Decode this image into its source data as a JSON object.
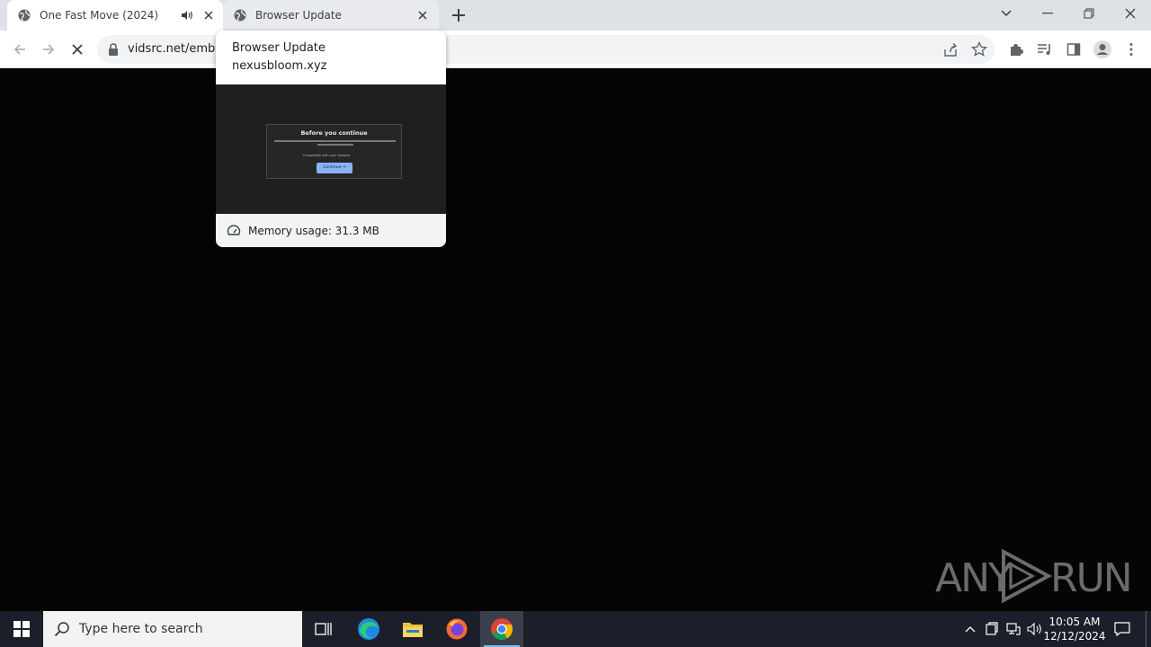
{
  "browser": {
    "tabs": [
      {
        "title": "One Fast Move (2024)",
        "active": true,
        "audio": true
      },
      {
        "title": "Browser Update",
        "active": false,
        "audio": false
      }
    ],
    "url": "vidsrc.net/embe"
  },
  "hover_card": {
    "title": "Browser Update",
    "domain": "nexusbloom.xyz",
    "preview": {
      "dialog_title": "Before you continue",
      "checkbox_text": "Compatible with your browser",
      "button_label": "Continue ⇒"
    },
    "memory": "Memory usage: 31.3 MB"
  },
  "watermark": {
    "left": "ANY",
    "right": "RUN"
  },
  "taskbar": {
    "search_placeholder": "Type here to search",
    "time": "10:05 AM",
    "date": "12/12/2024"
  },
  "colors": {
    "tabstrip": "#dee1e6",
    "page_bg": "#070504",
    "taskbar": "#1b1f2a",
    "accent": "#8ab4f8"
  }
}
